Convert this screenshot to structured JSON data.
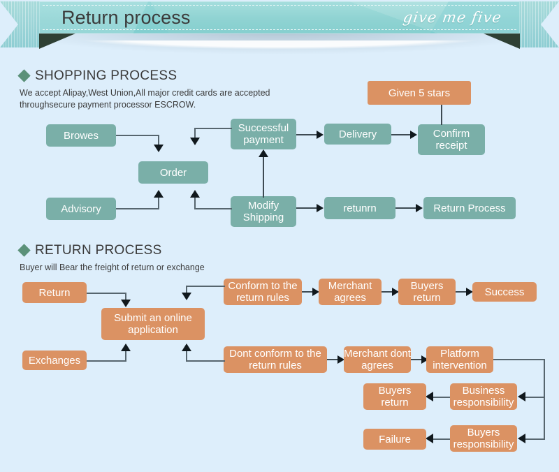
{
  "banner": {
    "title": "Return process",
    "signature": "give me five"
  },
  "sections": [
    {
      "heading": "SHOPPING PROCESS",
      "subtitle": "We accept Alipay,West Union,All major credit cards are accepted throughsecure payment processor ESCROW.",
      "nodes": {
        "browes": "Browes",
        "order": "Order",
        "advisory": "Advisory",
        "successful_payment": "Successful payment",
        "modify_shipping": "Modify Shipping",
        "delivery": "Delivery",
        "confirm_receipt": "Confirm receipt",
        "given_5_stars": "Given 5 stars",
        "retunrn": "retunrn",
        "return_process": "Return Process"
      }
    },
    {
      "heading": "RETURN PROCESS",
      "subtitle": "Buyer will Bear the freight of return or exchange",
      "nodes": {
        "return": "Return",
        "submit_online": "Submit an online application",
        "exchanges": "Exchanges",
        "conform_rules": "Conform to the return rules",
        "merchant_agrees": "Merchant agrees",
        "buyers_return_top": "Buyers return",
        "success": "Success",
        "dont_conform_rules": "Dont conform to the return rules",
        "merchant_dont_agrees": "Merchant dont agrees",
        "platform_intervention": "Platform intervention",
        "business_responsibility": "Business responsibility",
        "buyers_return_bottom": "Buyers return",
        "buyers_responsibility": "Buyers responsibility",
        "failure": "Failure"
      }
    }
  ],
  "colors": {
    "page_background": "#ddeefb",
    "teal_node": "#7aafa8",
    "orange_node": "#db9263",
    "banner": "#8fd3d2",
    "diamond": "#5b9179",
    "connector": "#3d4a52"
  }
}
